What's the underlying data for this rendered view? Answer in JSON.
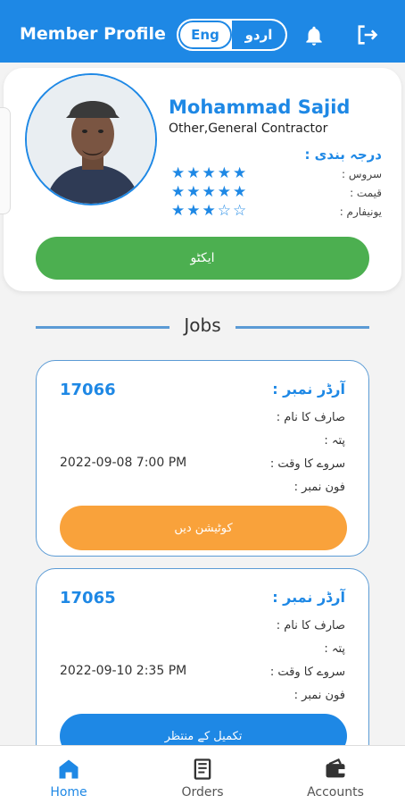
{
  "header": {
    "title": "Member Profile",
    "lang_eng": "Eng",
    "lang_urdu": "اردو",
    "icons": [
      "bell-icon",
      "logout-icon"
    ]
  },
  "profile": {
    "name": "Mohammad Sajid",
    "profession": "Other,General Contractor",
    "rating_title": "درجہ بندی :",
    "ratings": [
      {
        "label": "سروس :",
        "stars": 5
      },
      {
        "label": "قیمت :",
        "stars": 5
      },
      {
        "label": "یونیفارم :",
        "stars": 3
      }
    ],
    "status_button": "ایکٹو"
  },
  "jobs_section": {
    "title": "Jobs"
  },
  "jobs": [
    {
      "order_id": "17066",
      "order_label": "آرڈر نمبر :",
      "customer_label": "صارف کا نام :",
      "address_label": "پتہ :",
      "survey_time_label": "سروے کا وقت :",
      "phone_label": "فون نمبر :",
      "survey_time": "2022-09-08 7:00 PM",
      "action_label": "کوٹیشن دیں",
      "action_color": "#f9a23b"
    },
    {
      "order_id": "17065",
      "order_label": "آرڈر نمبر :",
      "customer_label": "صارف کا نام :",
      "address_label": "پتہ :",
      "survey_time_label": "سروے کا وقت :",
      "phone_label": "فون نمبر :",
      "survey_time": "2022-09-10 2:35 PM",
      "action_label": "تکمیل کے منتظر",
      "action_color": "#1e88e5"
    }
  ],
  "nav": [
    {
      "label": "Home",
      "icon": "home-icon",
      "active": true
    },
    {
      "label": "Orders",
      "icon": "orders-icon",
      "active": false
    },
    {
      "label": "Accounts",
      "icon": "wallet-icon",
      "active": false
    }
  ],
  "colors": {
    "primary": "#1e88e5",
    "active_green": "#4caf50",
    "orange": "#f9a23b"
  }
}
